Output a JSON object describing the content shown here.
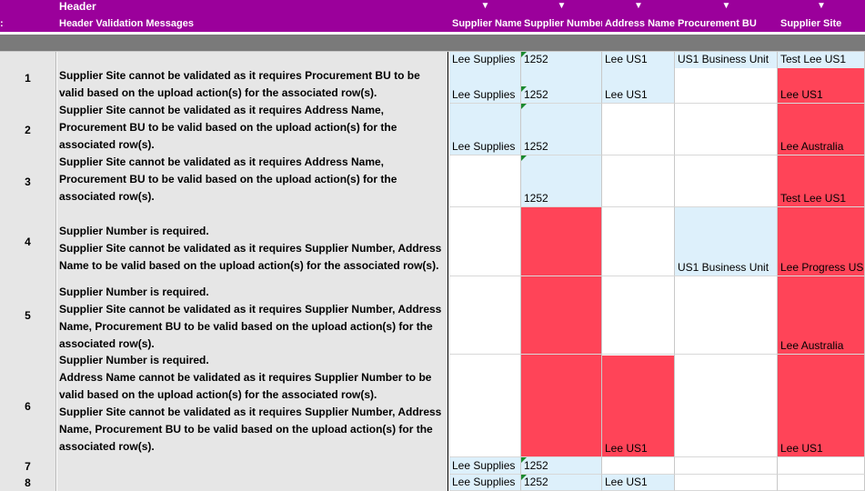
{
  "header": {
    "title": "Header",
    "subtitle": "Header Validation Messages",
    "left_fragment": ":",
    "arrow_glyph": "▼",
    "columns": [
      "Supplier Name",
      "Supplier Number",
      "Address Name",
      "Procurement BU",
      "Supplier Site"
    ]
  },
  "rows": [
    {
      "num": "1",
      "messages": [
        "Supplier Site cannot be validated as it requires Procurement BU to be",
        "valid based on the upload action(s) for the associated row(s)."
      ],
      "cells": {
        "supplier_name": "Lee Supplies",
        "supplier_name_top": "Lee Supplies",
        "supplier_number": "1252",
        "supplier_number_top": "1252",
        "address_name": "Lee US1",
        "address_name_top": "Lee US1",
        "procurement_bu": "",
        "procurement_bu_top": "US1 Business Unit",
        "supplier_site": "Lee US1",
        "supplier_site_top": "Test Lee US1"
      }
    },
    {
      "num": "2",
      "messages": [
        "Supplier Site cannot be validated as it requires Address Name,",
        "Procurement BU to be valid based on the upload action(s) for the",
        "associated row(s)."
      ],
      "cells": {
        "supplier_name": "Lee Supplies",
        "supplier_number": "1252",
        "address_name": "",
        "procurement_bu": "",
        "supplier_site": "Lee Australia"
      }
    },
    {
      "num": "3",
      "messages": [
        "Supplier Site cannot be validated as it requires Address Name,",
        "Procurement BU to be valid based on the upload action(s) for the",
        "associated row(s)."
      ],
      "cells": {
        "supplier_name": "",
        "supplier_number": "1252",
        "address_name": "",
        "procurement_bu": "",
        "supplier_site": "Test Lee US1"
      }
    },
    {
      "num": "4",
      "messages": [
        "Supplier Number is required.",
        "Supplier Site cannot be validated as it requires Supplier Number, Address",
        "Name to be valid based on the upload action(s) for the associated row(s)."
      ],
      "cells": {
        "supplier_name": "",
        "supplier_number": "",
        "address_name": "",
        "procurement_bu": "US1 Business Unit",
        "supplier_site": "Lee Progress US"
      }
    },
    {
      "num": "5",
      "messages": [
        "Supplier Number is required.",
        "Supplier Site cannot be validated as it requires Supplier Number, Address",
        "Name, Procurement BU to be valid based on the upload action(s) for the",
        "associated row(s)."
      ],
      "cells": {
        "supplier_name": "",
        "supplier_number": "",
        "address_name": "",
        "procurement_bu": "",
        "supplier_site": "Lee Australia"
      }
    },
    {
      "num": "6",
      "messages": [
        "Supplier Number is required.",
        "Address Name cannot be validated as it requires Supplier Number to be",
        "valid based on the upload action(s) for the associated row(s).",
        "Supplier Site cannot be validated as it requires Supplier Number, Address",
        "Name, Procurement BU to be valid based on the upload action(s) for the",
        "associated row(s)."
      ],
      "cells": {
        "supplier_name": "",
        "supplier_number": "",
        "address_name": "Lee US1",
        "procurement_bu": "",
        "supplier_site": "Lee US1"
      }
    },
    {
      "num": "7",
      "messages": [],
      "cells": {
        "supplier_name": "Lee Supplies",
        "supplier_number": "1252",
        "address_name": "",
        "procurement_bu": "",
        "supplier_site": ""
      }
    },
    {
      "num": "8",
      "messages": [],
      "cells": {
        "supplier_name": "Lee Supplies",
        "supplier_number": "1252",
        "address_name": "Lee US1",
        "procurement_bu": "",
        "supplier_site": ""
      }
    }
  ],
  "colors": {
    "header_purple": "#9b009b",
    "error_red": "#ff4458",
    "valid_blue": "#ddf0fb",
    "message_gray": "#e6e6e6"
  }
}
